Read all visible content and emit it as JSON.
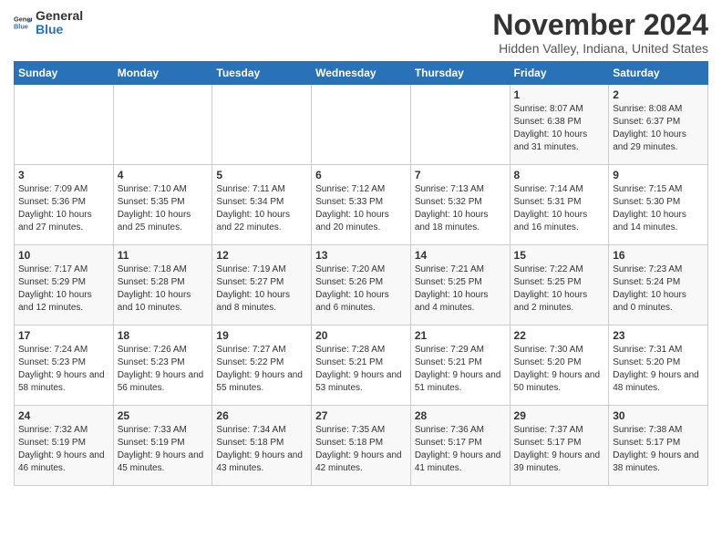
{
  "logo": {
    "general": "General",
    "blue": "Blue"
  },
  "title": "November 2024",
  "subtitle": "Hidden Valley, Indiana, United States",
  "days_of_week": [
    "Sunday",
    "Monday",
    "Tuesday",
    "Wednesday",
    "Thursday",
    "Friday",
    "Saturday"
  ],
  "weeks": [
    [
      null,
      null,
      null,
      null,
      null,
      {
        "day": "1",
        "sunrise": "8:07 AM",
        "sunset": "6:38 PM",
        "daylight": "10 hours and 31 minutes."
      },
      {
        "day": "2",
        "sunrise": "8:08 AM",
        "sunset": "6:37 PM",
        "daylight": "10 hours and 29 minutes."
      }
    ],
    [
      {
        "day": "3",
        "sunrise": "7:09 AM",
        "sunset": "5:36 PM",
        "daylight": "10 hours and 27 minutes."
      },
      {
        "day": "4",
        "sunrise": "7:10 AM",
        "sunset": "5:35 PM",
        "daylight": "10 hours and 25 minutes."
      },
      {
        "day": "5",
        "sunrise": "7:11 AM",
        "sunset": "5:34 PM",
        "daylight": "10 hours and 22 minutes."
      },
      {
        "day": "6",
        "sunrise": "7:12 AM",
        "sunset": "5:33 PM",
        "daylight": "10 hours and 20 minutes."
      },
      {
        "day": "7",
        "sunrise": "7:13 AM",
        "sunset": "5:32 PM",
        "daylight": "10 hours and 18 minutes."
      },
      {
        "day": "8",
        "sunrise": "7:14 AM",
        "sunset": "5:31 PM",
        "daylight": "10 hours and 16 minutes."
      },
      {
        "day": "9",
        "sunrise": "7:15 AM",
        "sunset": "5:30 PM",
        "daylight": "10 hours and 14 minutes."
      }
    ],
    [
      {
        "day": "10",
        "sunrise": "7:17 AM",
        "sunset": "5:29 PM",
        "daylight": "10 hours and 12 minutes."
      },
      {
        "day": "11",
        "sunrise": "7:18 AM",
        "sunset": "5:28 PM",
        "daylight": "10 hours and 10 minutes."
      },
      {
        "day": "12",
        "sunrise": "7:19 AM",
        "sunset": "5:27 PM",
        "daylight": "10 hours and 8 minutes."
      },
      {
        "day": "13",
        "sunrise": "7:20 AM",
        "sunset": "5:26 PM",
        "daylight": "10 hours and 6 minutes."
      },
      {
        "day": "14",
        "sunrise": "7:21 AM",
        "sunset": "5:25 PM",
        "daylight": "10 hours and 4 minutes."
      },
      {
        "day": "15",
        "sunrise": "7:22 AM",
        "sunset": "5:25 PM",
        "daylight": "10 hours and 2 minutes."
      },
      {
        "day": "16",
        "sunrise": "7:23 AM",
        "sunset": "5:24 PM",
        "daylight": "10 hours and 0 minutes."
      }
    ],
    [
      {
        "day": "17",
        "sunrise": "7:24 AM",
        "sunset": "5:23 PM",
        "daylight": "9 hours and 58 minutes."
      },
      {
        "day": "18",
        "sunrise": "7:26 AM",
        "sunset": "5:23 PM",
        "daylight": "9 hours and 56 minutes."
      },
      {
        "day": "19",
        "sunrise": "7:27 AM",
        "sunset": "5:22 PM",
        "daylight": "9 hours and 55 minutes."
      },
      {
        "day": "20",
        "sunrise": "7:28 AM",
        "sunset": "5:21 PM",
        "daylight": "9 hours and 53 minutes."
      },
      {
        "day": "21",
        "sunrise": "7:29 AM",
        "sunset": "5:21 PM",
        "daylight": "9 hours and 51 minutes."
      },
      {
        "day": "22",
        "sunrise": "7:30 AM",
        "sunset": "5:20 PM",
        "daylight": "9 hours and 50 minutes."
      },
      {
        "day": "23",
        "sunrise": "7:31 AM",
        "sunset": "5:20 PM",
        "daylight": "9 hours and 48 minutes."
      }
    ],
    [
      {
        "day": "24",
        "sunrise": "7:32 AM",
        "sunset": "5:19 PM",
        "daylight": "9 hours and 46 minutes."
      },
      {
        "day": "25",
        "sunrise": "7:33 AM",
        "sunset": "5:19 PM",
        "daylight": "9 hours and 45 minutes."
      },
      {
        "day": "26",
        "sunrise": "7:34 AM",
        "sunset": "5:18 PM",
        "daylight": "9 hours and 43 minutes."
      },
      {
        "day": "27",
        "sunrise": "7:35 AM",
        "sunset": "5:18 PM",
        "daylight": "9 hours and 42 minutes."
      },
      {
        "day": "28",
        "sunrise": "7:36 AM",
        "sunset": "5:17 PM",
        "daylight": "9 hours and 41 minutes."
      },
      {
        "day": "29",
        "sunrise": "7:37 AM",
        "sunset": "5:17 PM",
        "daylight": "9 hours and 39 minutes."
      },
      {
        "day": "30",
        "sunrise": "7:38 AM",
        "sunset": "5:17 PM",
        "daylight": "9 hours and 38 minutes."
      }
    ]
  ]
}
